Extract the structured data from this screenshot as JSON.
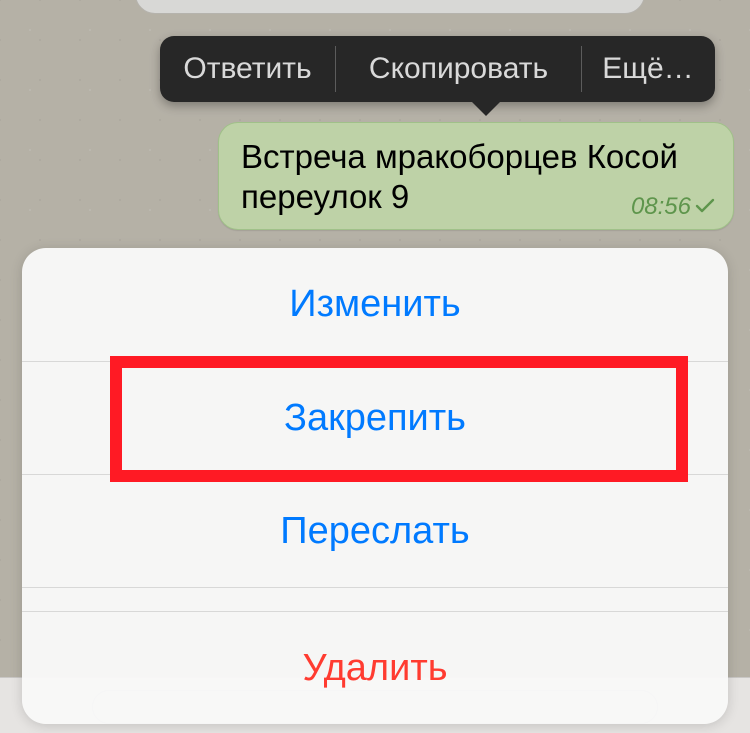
{
  "popover": {
    "reply": "Ответить",
    "copy": "Скопировать",
    "more": "Ещё…"
  },
  "message": {
    "text": "Встреча мракоборцев Косой переулок 9",
    "time": "08:56"
  },
  "sheet": {
    "edit": "Изменить",
    "pin": "Закрепить",
    "forward": "Переслать",
    "delete": "Удалить"
  }
}
